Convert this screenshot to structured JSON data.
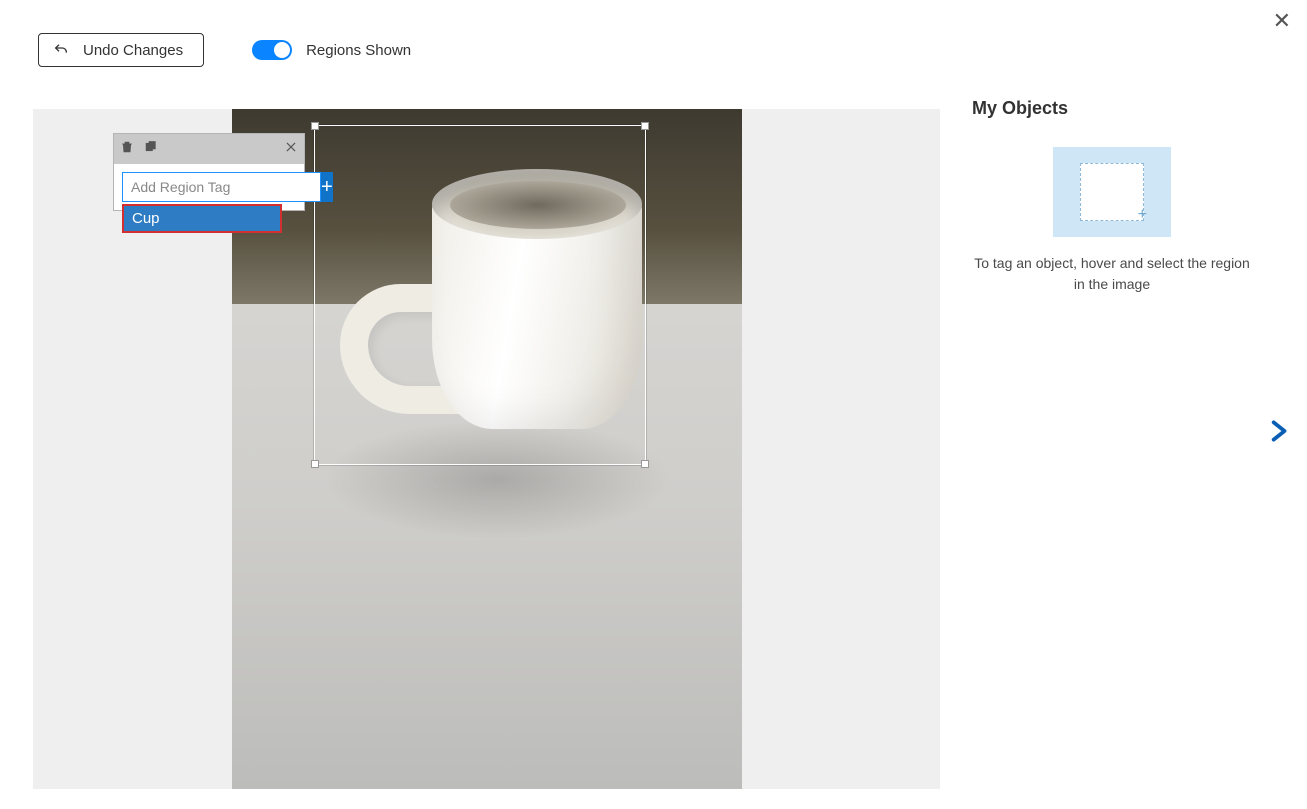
{
  "toolbar": {
    "undo_label": "Undo Changes",
    "toggle_label": "Regions Shown",
    "toggle_on": true
  },
  "popup": {
    "placeholder": "Add Region Tag",
    "add_symbol": "+",
    "suggestion": "Cup"
  },
  "sidebar": {
    "title": "My Objects",
    "hint": "To tag an object, hover and select the region in the image"
  }
}
